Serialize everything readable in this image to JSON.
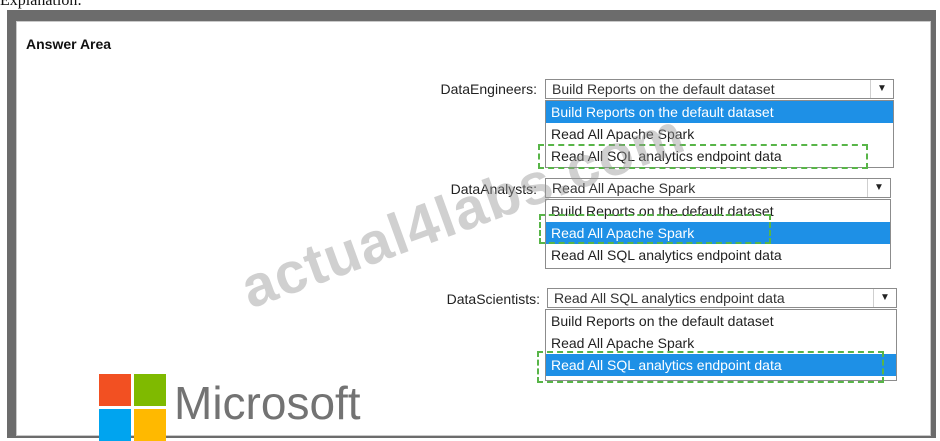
{
  "caption": "Explanation:",
  "panel": {
    "title": "Answer Area"
  },
  "rows": [
    {
      "label": "DataEngineers:",
      "selected": "Build Reports on the default dataset",
      "options": [
        "Build Reports on the default dataset",
        "Read All Apache Spark",
        "Read All SQL analytics endpoint data"
      ],
      "highlighted_index": 0
    },
    {
      "label": "DataAnalysts:",
      "selected": "Read All Apache Spark",
      "options": [
        "Build Reports on the default dataset",
        "Read All Apache Spark",
        "Read All SQL analytics endpoint data"
      ],
      "highlighted_index": 1
    },
    {
      "label": "DataScientists:",
      "selected": "Read All SQL analytics endpoint data",
      "options": [
        "Build Reports on the default dataset",
        "Read All Apache Spark",
        "Read All SQL analytics endpoint data"
      ],
      "highlighted_index": 2
    }
  ],
  "watermark": "actual4labs.com",
  "logo": {
    "wordmark": "Microsoft",
    "colors": [
      "#f25022",
      "#7fba00",
      "#00a4ef",
      "#ffb900"
    ]
  },
  "colors": {
    "highlight": "#1e90e6",
    "dash": "#58b548",
    "frame": "#6c6c6c"
  }
}
